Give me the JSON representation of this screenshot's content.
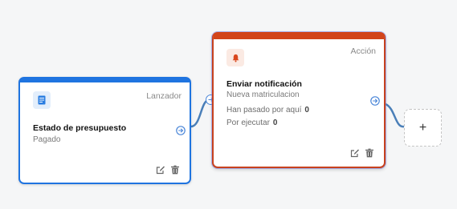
{
  "trigger_node": {
    "icon": "document-icon",
    "type_label": "Lanzador",
    "title": "Estado de presupuesto",
    "subtitle": "Pagado",
    "accent_color": "#1f74e0"
  },
  "action_node": {
    "icon": "bell-icon",
    "type_label": "Acción",
    "title": "Enviar notificación",
    "subtitle": "Nueva matriculacion",
    "stats": [
      {
        "label": "Han pasado por aquí",
        "value": "0"
      },
      {
        "label": "Por ejecutar",
        "value": "0"
      }
    ],
    "accent_color": "#d2441a"
  },
  "add_node": {
    "label": "+"
  },
  "connector_color": "#4a86d8"
}
